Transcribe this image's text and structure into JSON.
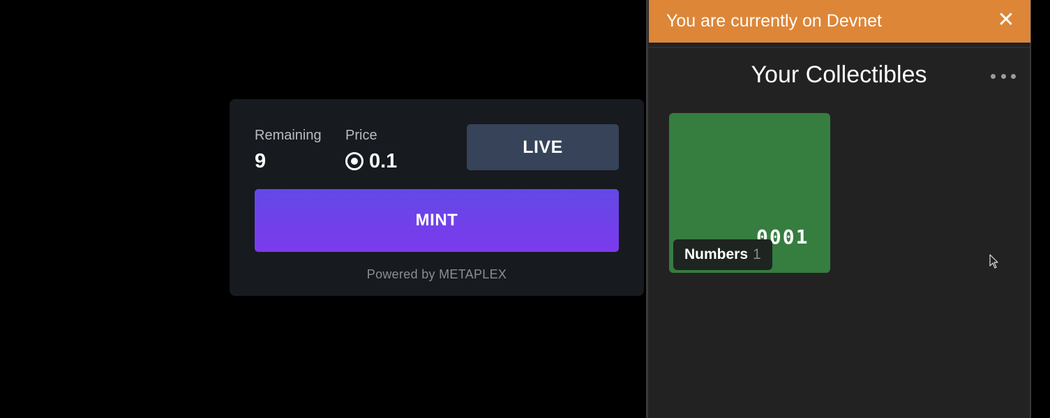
{
  "mint": {
    "remaining_label": "Remaining",
    "remaining_value": "9",
    "price_label": "Price",
    "price_value": "0.1",
    "currency_icon": "solana-icon",
    "live_label": "LIVE",
    "mint_label": "MINT",
    "powered_by": "Powered by METAPLEX"
  },
  "wallet": {
    "banner_text": "You are currently on Devnet",
    "banner_close": "✕",
    "title": "Your Collectibles",
    "more_icon": "more-horizontal-icon",
    "collectibles": [
      {
        "number_art": "0001",
        "collection_name": "Numbers",
        "count": "1"
      }
    ]
  },
  "colors": {
    "page_bg": "#000000",
    "card_bg": "#171a1f",
    "live_bg": "#364359",
    "mint_gradient_start": "#6349e6",
    "mint_gradient_end": "#7c3aed",
    "banner_bg": "#dd8638",
    "panel_bg": "#222222",
    "collectible_bg": "#367d40"
  }
}
